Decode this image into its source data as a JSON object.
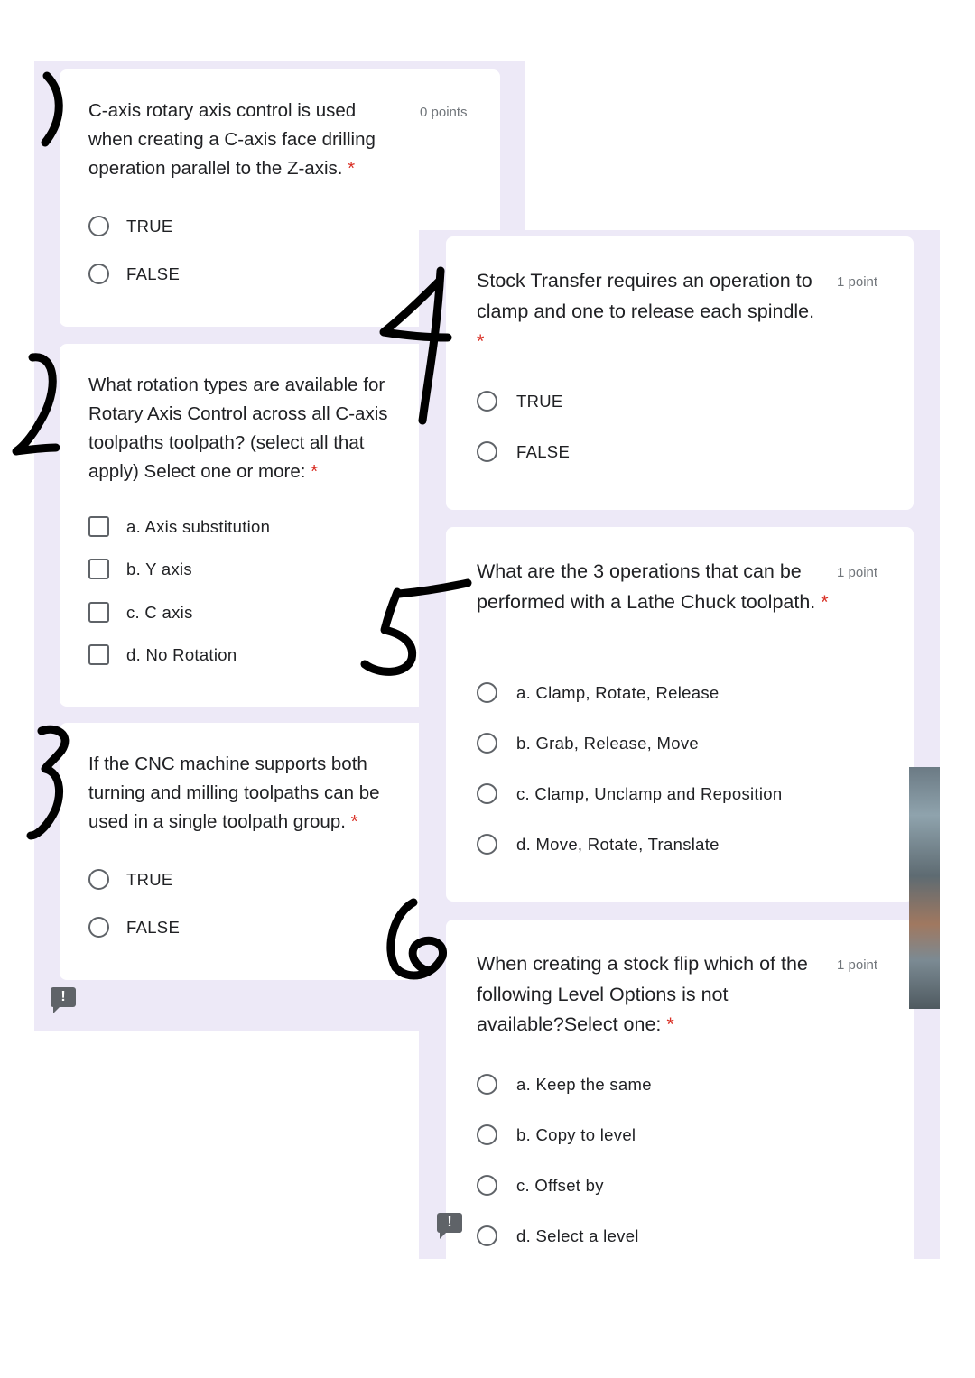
{
  "questions": [
    {
      "text": "C-axis rotary axis control is used when creating a C-axis face drilling operation parallel to the Z-axis.",
      "required": "*",
      "points": "0 points",
      "options": [
        "TRUE",
        "FALSE"
      ]
    },
    {
      "text": "What rotation types are available for Rotary Axis Control across all C-axis toolpaths toolpath? (select all that apply) Select one or more:",
      "required": "*",
      "options": [
        "a. Axis substitution",
        "b. Y axis",
        "c. C axis",
        "d. No Rotation"
      ]
    },
    {
      "text": "If the CNC machine supports both turning and milling toolpaths can be used in a single toolpath group.",
      "required": "*",
      "options": [
        "TRUE",
        "FALSE"
      ]
    },
    {
      "text": "Stock Transfer requires an operation to clamp and one to release each spindle.",
      "required": "*",
      "points": "1 point",
      "options": [
        "TRUE",
        "FALSE"
      ]
    },
    {
      "text": "What are the 3 operations that can be performed with a Lathe Chuck toolpath.",
      "required": "*",
      "points": "1 point",
      "options": [
        "a. Clamp, Rotate, Release",
        "b. Grab, Release, Move",
        "c. Clamp, Unclamp and Reposition",
        "d. Move, Rotate, Translate"
      ]
    },
    {
      "text": "When creating a stock flip which of the following Level Options is not available?Select one:",
      "required": "*",
      "points": "1 point",
      "options": [
        "a. Keep the same",
        "b. Copy to level",
        "c. Offset by",
        "d. Select a level"
      ]
    }
  ],
  "icons": {
    "report": "report-issue-icon",
    "report_glyph": "!"
  },
  "colors": {
    "panel": "#ede9f7",
    "required": "#d93025",
    "points": "#70757a"
  }
}
